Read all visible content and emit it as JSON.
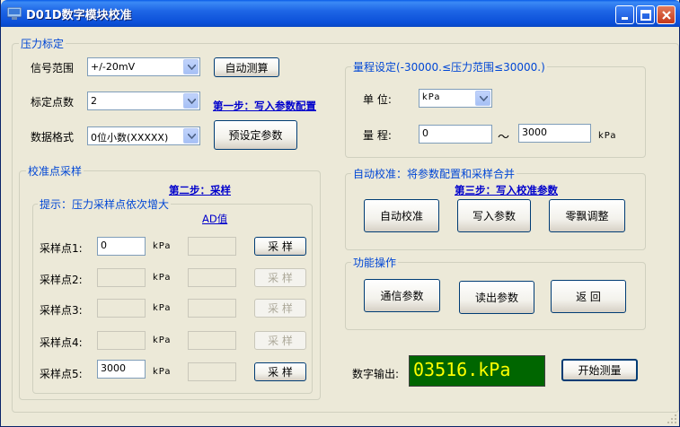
{
  "window": {
    "title": "D01D数字模块校准"
  },
  "pressure": {
    "group_label": "压力标定",
    "signal_range_label": "信号范围",
    "signal_range_value": "+/-20mV",
    "auto_measure_button": "自动测算",
    "calib_points_label": "标定点数",
    "calib_points_value": "2",
    "data_format_label": "数据格式",
    "data_format_value": "0位小数(XXXXX)",
    "preset_button": "预设定参数",
    "step1_link": "第一步：写入参数配置"
  },
  "sampling": {
    "group_label": "校准点采样",
    "step2_link": "第二步：采样",
    "hint_label": "提示：压力采样点依次增大",
    "ad_header": "AD值",
    "unit": "kPa",
    "sample_button": "采 样",
    "points": [
      {
        "label": "采样点1:",
        "value": "0",
        "ad": "",
        "enabled": true
      },
      {
        "label": "采样点2:",
        "value": "",
        "ad": "",
        "enabled": false
      },
      {
        "label": "采样点3:",
        "value": "",
        "ad": "",
        "enabled": false
      },
      {
        "label": "采样点4:",
        "value": "",
        "ad": "",
        "enabled": false
      },
      {
        "label": "采样点5:",
        "value": "3000",
        "ad": "",
        "enabled": true
      }
    ]
  },
  "range": {
    "group_label": "量程设定(-30000.≤压力范围≤30000.)",
    "unit_label": "单  位:",
    "unit_value": "kPa",
    "range_label": "量  程:",
    "range_min": "0",
    "tilde": "～",
    "range_max": "3000",
    "range_unit": "kPa"
  },
  "auto_calib": {
    "group_label": "自动校准：将参数配置和采样合并",
    "step3_link": "第三步：写入校准参数",
    "auto_calib_button": "自动校准",
    "write_params_button": "写入参数",
    "zero_drift_button": "零飘调整"
  },
  "functions": {
    "group_label": "功能操作",
    "comm_params_button": "通信参数",
    "read_params_button": "读出参数",
    "back_button": "返  回"
  },
  "output": {
    "label": "数字输出:",
    "value": "03516.kPa",
    "start_button": "开始测量"
  },
  "colors": {
    "titlebar": "#0A5CE8",
    "group_label": "#0046D5",
    "display_bg": "#006600",
    "display_fg": "#FFFF00",
    "link": "#0000CC"
  }
}
